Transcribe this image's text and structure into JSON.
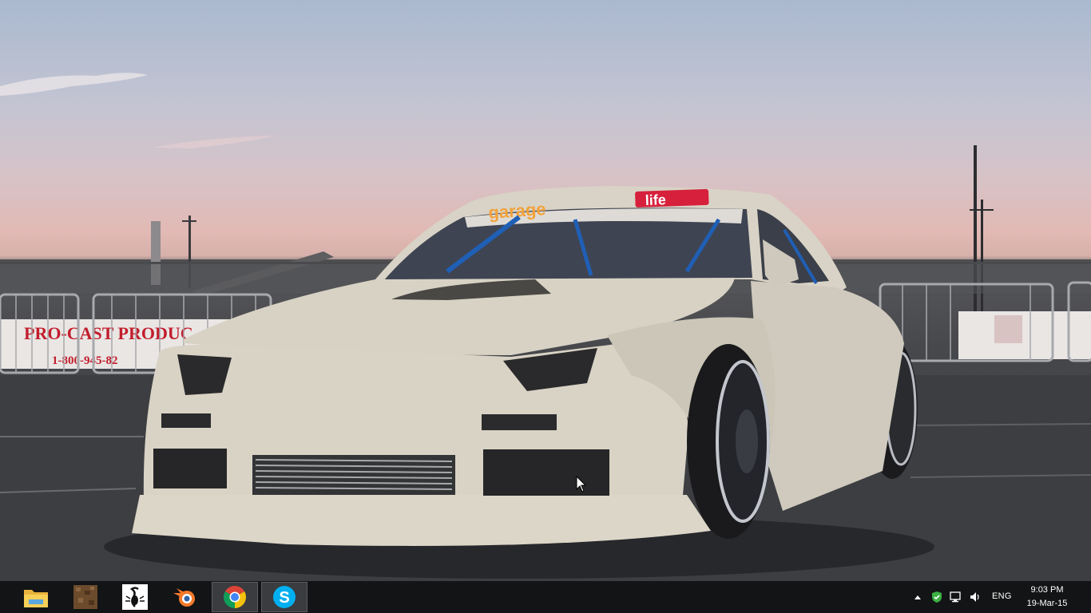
{
  "wallpaper": {
    "windshield_banner": "garage",
    "windshield_banner_brand": "life",
    "fence_sign": "PRO-CAST PRODUC",
    "fence_phone": "1-800-945-82"
  },
  "taskbar": {
    "pinned": [
      {
        "name": "file-explorer",
        "icon": "folder-icon",
        "active": false
      },
      {
        "name": "minecraft",
        "icon": "dirt-block-icon",
        "active": false
      },
      {
        "name": "scorpion-app",
        "icon": "scorpion-icon",
        "active": false
      },
      {
        "name": "blender",
        "icon": "blender-icon",
        "active": false
      },
      {
        "name": "chrome",
        "icon": "chrome-icon",
        "active": true
      },
      {
        "name": "skype",
        "icon": "skype-icon",
        "active": true
      }
    ],
    "tray": {
      "language": "ENG",
      "time": "9:03 PM",
      "date": "19-Mar-15"
    }
  },
  "colors": {
    "taskbar_bg": "#131415",
    "active_button_bg": "#3a3c3f",
    "text": "#ffffff",
    "chrome_red": "#db4437",
    "chrome_yellow": "#f4c20d",
    "chrome_green": "#0f9d58",
    "chrome_blue": "#4285f4",
    "skype_blue": "#00aff0",
    "blender_orange": "#f5792a",
    "banner_red": "#d6203c"
  }
}
